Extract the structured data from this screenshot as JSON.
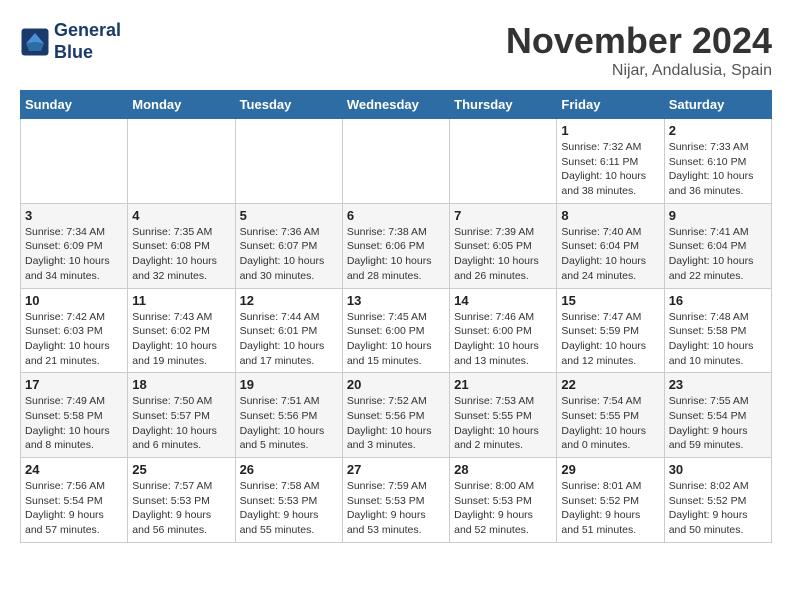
{
  "header": {
    "logo_line1": "General",
    "logo_line2": "Blue",
    "month": "November 2024",
    "location": "Nijar, Andalusia, Spain"
  },
  "weekdays": [
    "Sunday",
    "Monday",
    "Tuesday",
    "Wednesday",
    "Thursday",
    "Friday",
    "Saturday"
  ],
  "weeks": [
    [
      {
        "day": "",
        "info": ""
      },
      {
        "day": "",
        "info": ""
      },
      {
        "day": "",
        "info": ""
      },
      {
        "day": "",
        "info": ""
      },
      {
        "day": "",
        "info": ""
      },
      {
        "day": "1",
        "info": "Sunrise: 7:32 AM\nSunset: 6:11 PM\nDaylight: 10 hours and 38 minutes."
      },
      {
        "day": "2",
        "info": "Sunrise: 7:33 AM\nSunset: 6:10 PM\nDaylight: 10 hours and 36 minutes."
      }
    ],
    [
      {
        "day": "3",
        "info": "Sunrise: 7:34 AM\nSunset: 6:09 PM\nDaylight: 10 hours and 34 minutes."
      },
      {
        "day": "4",
        "info": "Sunrise: 7:35 AM\nSunset: 6:08 PM\nDaylight: 10 hours and 32 minutes."
      },
      {
        "day": "5",
        "info": "Sunrise: 7:36 AM\nSunset: 6:07 PM\nDaylight: 10 hours and 30 minutes."
      },
      {
        "day": "6",
        "info": "Sunrise: 7:38 AM\nSunset: 6:06 PM\nDaylight: 10 hours and 28 minutes."
      },
      {
        "day": "7",
        "info": "Sunrise: 7:39 AM\nSunset: 6:05 PM\nDaylight: 10 hours and 26 minutes."
      },
      {
        "day": "8",
        "info": "Sunrise: 7:40 AM\nSunset: 6:04 PM\nDaylight: 10 hours and 24 minutes."
      },
      {
        "day": "9",
        "info": "Sunrise: 7:41 AM\nSunset: 6:04 PM\nDaylight: 10 hours and 22 minutes."
      }
    ],
    [
      {
        "day": "10",
        "info": "Sunrise: 7:42 AM\nSunset: 6:03 PM\nDaylight: 10 hours and 21 minutes."
      },
      {
        "day": "11",
        "info": "Sunrise: 7:43 AM\nSunset: 6:02 PM\nDaylight: 10 hours and 19 minutes."
      },
      {
        "day": "12",
        "info": "Sunrise: 7:44 AM\nSunset: 6:01 PM\nDaylight: 10 hours and 17 minutes."
      },
      {
        "day": "13",
        "info": "Sunrise: 7:45 AM\nSunset: 6:00 PM\nDaylight: 10 hours and 15 minutes."
      },
      {
        "day": "14",
        "info": "Sunrise: 7:46 AM\nSunset: 6:00 PM\nDaylight: 10 hours and 13 minutes."
      },
      {
        "day": "15",
        "info": "Sunrise: 7:47 AM\nSunset: 5:59 PM\nDaylight: 10 hours and 12 minutes."
      },
      {
        "day": "16",
        "info": "Sunrise: 7:48 AM\nSunset: 5:58 PM\nDaylight: 10 hours and 10 minutes."
      }
    ],
    [
      {
        "day": "17",
        "info": "Sunrise: 7:49 AM\nSunset: 5:58 PM\nDaylight: 10 hours and 8 minutes."
      },
      {
        "day": "18",
        "info": "Sunrise: 7:50 AM\nSunset: 5:57 PM\nDaylight: 10 hours and 6 minutes."
      },
      {
        "day": "19",
        "info": "Sunrise: 7:51 AM\nSunset: 5:56 PM\nDaylight: 10 hours and 5 minutes."
      },
      {
        "day": "20",
        "info": "Sunrise: 7:52 AM\nSunset: 5:56 PM\nDaylight: 10 hours and 3 minutes."
      },
      {
        "day": "21",
        "info": "Sunrise: 7:53 AM\nSunset: 5:55 PM\nDaylight: 10 hours and 2 minutes."
      },
      {
        "day": "22",
        "info": "Sunrise: 7:54 AM\nSunset: 5:55 PM\nDaylight: 10 hours and 0 minutes."
      },
      {
        "day": "23",
        "info": "Sunrise: 7:55 AM\nSunset: 5:54 PM\nDaylight: 9 hours and 59 minutes."
      }
    ],
    [
      {
        "day": "24",
        "info": "Sunrise: 7:56 AM\nSunset: 5:54 PM\nDaylight: 9 hours and 57 minutes."
      },
      {
        "day": "25",
        "info": "Sunrise: 7:57 AM\nSunset: 5:53 PM\nDaylight: 9 hours and 56 minutes."
      },
      {
        "day": "26",
        "info": "Sunrise: 7:58 AM\nSunset: 5:53 PM\nDaylight: 9 hours and 55 minutes."
      },
      {
        "day": "27",
        "info": "Sunrise: 7:59 AM\nSunset: 5:53 PM\nDaylight: 9 hours and 53 minutes."
      },
      {
        "day": "28",
        "info": "Sunrise: 8:00 AM\nSunset: 5:53 PM\nDaylight: 9 hours and 52 minutes."
      },
      {
        "day": "29",
        "info": "Sunrise: 8:01 AM\nSunset: 5:52 PM\nDaylight: 9 hours and 51 minutes."
      },
      {
        "day": "30",
        "info": "Sunrise: 8:02 AM\nSunset: 5:52 PM\nDaylight: 9 hours and 50 minutes."
      }
    ]
  ]
}
